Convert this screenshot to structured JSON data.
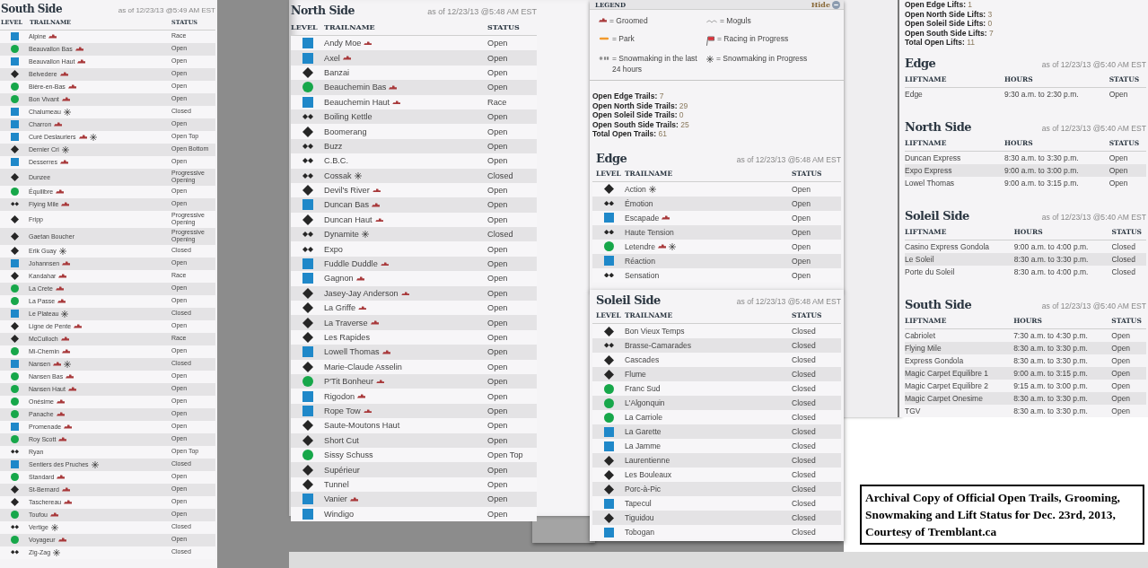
{
  "south_trails": {
    "title": "South Side",
    "as_of": "as of 12/23/13 @5:49 AM EST",
    "columns": [
      "LEVEL",
      "TRAILNAME",
      "STATUS"
    ],
    "rows": [
      {
        "name": "Alpine",
        "kind": "square",
        "groomed": true,
        "snowmaking": false,
        "status": "Race"
      },
      {
        "name": "Beauvallon Bas",
        "kind": "circle",
        "groomed": true,
        "snowmaking": false,
        "status": "Open"
      },
      {
        "name": "Beauvallon Haut",
        "kind": "square",
        "groomed": true,
        "snowmaking": false,
        "status": "Open"
      },
      {
        "name": "Belvedere",
        "kind": "diamond",
        "groomed": true,
        "snowmaking": false,
        "status": "Open"
      },
      {
        "name": "Bière-en-Bas",
        "kind": "circle",
        "groomed": true,
        "snowmaking": false,
        "status": "Open"
      },
      {
        "name": "Bon Vivant",
        "kind": "circle",
        "groomed": true,
        "snowmaking": false,
        "status": "Open"
      },
      {
        "name": "Chalumeau",
        "kind": "square",
        "groomed": false,
        "snowmaking": true,
        "status": "Closed"
      },
      {
        "name": "Charron",
        "kind": "square",
        "groomed": true,
        "snowmaking": false,
        "status": "Open"
      },
      {
        "name": "Curé Deslauriers",
        "kind": "square",
        "groomed": true,
        "snowmaking": true,
        "status": "Open Top"
      },
      {
        "name": "Dernier Cri",
        "kind": "diamond",
        "groomed": false,
        "snowmaking": true,
        "status": "Open Bottom"
      },
      {
        "name": "Desserres",
        "kind": "square",
        "groomed": true,
        "snowmaking": false,
        "status": "Open"
      },
      {
        "name": "Dunzee",
        "kind": "diamond",
        "groomed": false,
        "snowmaking": false,
        "status": "Progressive Opening"
      },
      {
        "name": "Équilibre",
        "kind": "circle",
        "groomed": true,
        "snowmaking": false,
        "status": "Open"
      },
      {
        "name": "Flying Mile",
        "kind": "double_diamond",
        "groomed": true,
        "snowmaking": false,
        "status": "Open"
      },
      {
        "name": "Fripp",
        "kind": "diamond",
        "groomed": false,
        "snowmaking": false,
        "status": "Progressive Opening"
      },
      {
        "name": "Gaetan Boucher",
        "kind": "diamond",
        "groomed": false,
        "snowmaking": false,
        "status": "Progressive Opening"
      },
      {
        "name": "Erik Guay",
        "kind": "diamond",
        "groomed": false,
        "snowmaking": true,
        "status": "Closed"
      },
      {
        "name": "Johannsen",
        "kind": "square",
        "groomed": true,
        "snowmaking": false,
        "status": "Open"
      },
      {
        "name": "Kandahar",
        "kind": "diamond",
        "groomed": true,
        "snowmaking": false,
        "status": "Race"
      },
      {
        "name": "La Crete",
        "kind": "circle",
        "groomed": true,
        "snowmaking": false,
        "status": "Open"
      },
      {
        "name": "La Passe",
        "kind": "circle",
        "groomed": true,
        "snowmaking": false,
        "status": "Open"
      },
      {
        "name": "Le Plateau",
        "kind": "square",
        "groomed": false,
        "snowmaking": true,
        "status": "Closed"
      },
      {
        "name": "Ligne de Pente",
        "kind": "diamond",
        "groomed": true,
        "snowmaking": false,
        "status": "Open"
      },
      {
        "name": "McCulloch",
        "kind": "diamond",
        "groomed": true,
        "snowmaking": false,
        "status": "Race"
      },
      {
        "name": "Mi-Chemin",
        "kind": "circle",
        "groomed": true,
        "snowmaking": false,
        "status": "Open"
      },
      {
        "name": "Nansen",
        "kind": "square",
        "groomed": true,
        "snowmaking": true,
        "status": "Closed"
      },
      {
        "name": "Nansen Bas",
        "kind": "circle",
        "groomed": true,
        "snowmaking": false,
        "status": "Open"
      },
      {
        "name": "Nansen Haut",
        "kind": "circle",
        "groomed": true,
        "snowmaking": false,
        "status": "Open"
      },
      {
        "name": "Onésime",
        "kind": "circle",
        "groomed": true,
        "snowmaking": false,
        "status": "Open"
      },
      {
        "name": "Panache",
        "kind": "circle",
        "groomed": true,
        "snowmaking": false,
        "status": "Open"
      },
      {
        "name": "Promenade",
        "kind": "square",
        "groomed": true,
        "snowmaking": false,
        "status": "Open"
      },
      {
        "name": "Roy Scott",
        "kind": "circle",
        "groomed": true,
        "snowmaking": false,
        "status": "Open"
      },
      {
        "name": "Ryan",
        "kind": "double_diamond",
        "groomed": false,
        "snowmaking": false,
        "status": "Open Top"
      },
      {
        "name": "Sentiers des Pruches",
        "kind": "square",
        "groomed": false,
        "snowmaking": true,
        "status": "Closed"
      },
      {
        "name": "Standard",
        "kind": "circle",
        "groomed": true,
        "snowmaking": false,
        "status": "Open"
      },
      {
        "name": "St-Bernard",
        "kind": "diamond",
        "groomed": true,
        "snowmaking": false,
        "status": "Open"
      },
      {
        "name": "Taschereau",
        "kind": "diamond",
        "groomed": true,
        "snowmaking": false,
        "status": "Open"
      },
      {
        "name": "Toufou",
        "kind": "circle",
        "groomed": true,
        "snowmaking": false,
        "status": "Open"
      },
      {
        "name": "Vertige",
        "kind": "double_diamond",
        "groomed": false,
        "snowmaking": true,
        "status": "Closed"
      },
      {
        "name": "Voyageur",
        "kind": "circle",
        "groomed": true,
        "snowmaking": false,
        "status": "Open"
      },
      {
        "name": "Zig-Zag",
        "kind": "double_diamond",
        "groomed": false,
        "snowmaking": true,
        "status": "Closed"
      }
    ]
  },
  "north_trails": {
    "title": "North Side",
    "as_of": "as of 12/23/13 @5:48 AM EST",
    "columns": [
      "LEVEL",
      "TRAILNAME",
      "STATUS"
    ],
    "rows": [
      {
        "name": "Andy Moe",
        "kind": "square",
        "groomed": true,
        "snowmaking": false,
        "status": "Open"
      },
      {
        "name": "Axel",
        "kind": "square",
        "groomed": true,
        "snowmaking": false,
        "status": "Open"
      },
      {
        "name": "Banzai",
        "kind": "diamond",
        "groomed": false,
        "snowmaking": false,
        "status": "Open"
      },
      {
        "name": "Beauchemin Bas",
        "kind": "circle",
        "groomed": true,
        "snowmaking": false,
        "status": "Open"
      },
      {
        "name": "Beauchemin Haut",
        "kind": "square",
        "groomed": true,
        "snowmaking": false,
        "status": "Race"
      },
      {
        "name": "Boiling Kettle",
        "kind": "double_diamond",
        "groomed": false,
        "snowmaking": false,
        "status": "Open"
      },
      {
        "name": "Boomerang",
        "kind": "diamond",
        "groomed": false,
        "snowmaking": false,
        "status": "Open"
      },
      {
        "name": "Buzz",
        "kind": "double_diamond",
        "groomed": false,
        "snowmaking": false,
        "status": "Open"
      },
      {
        "name": "C.B.C.",
        "kind": "double_diamond",
        "groomed": false,
        "snowmaking": false,
        "status": "Open"
      },
      {
        "name": "Cossak",
        "kind": "double_diamond",
        "groomed": false,
        "snowmaking": true,
        "status": "Closed"
      },
      {
        "name": "Devil's River",
        "kind": "diamond",
        "groomed": true,
        "snowmaking": false,
        "status": "Open"
      },
      {
        "name": "Duncan Bas",
        "kind": "square",
        "groomed": true,
        "snowmaking": false,
        "status": "Open"
      },
      {
        "name": "Duncan Haut",
        "kind": "diamond",
        "groomed": true,
        "snowmaking": false,
        "status": "Open"
      },
      {
        "name": "Dynamite",
        "kind": "double_diamond",
        "groomed": false,
        "snowmaking": true,
        "status": "Closed"
      },
      {
        "name": "Expo",
        "kind": "double_diamond",
        "groomed": false,
        "snowmaking": false,
        "status": "Open"
      },
      {
        "name": "Fuddle Duddle",
        "kind": "square",
        "groomed": true,
        "snowmaking": false,
        "status": "Open"
      },
      {
        "name": "Gagnon",
        "kind": "square",
        "groomed": true,
        "snowmaking": false,
        "status": "Open"
      },
      {
        "name": "Jasey-Jay Anderson",
        "kind": "diamond",
        "groomed": true,
        "snowmaking": false,
        "status": "Open"
      },
      {
        "name": "La Griffe",
        "kind": "diamond",
        "groomed": true,
        "snowmaking": false,
        "status": "Open"
      },
      {
        "name": "La Traverse",
        "kind": "diamond",
        "groomed": true,
        "snowmaking": false,
        "status": "Open"
      },
      {
        "name": "Les Rapides",
        "kind": "diamond",
        "groomed": false,
        "snowmaking": false,
        "status": "Open"
      },
      {
        "name": "Lowell Thomas",
        "kind": "square",
        "groomed": true,
        "snowmaking": false,
        "status": "Open"
      },
      {
        "name": "Marie-Claude Asselin",
        "kind": "diamond",
        "groomed": false,
        "snowmaking": false,
        "status": "Open"
      },
      {
        "name": "P'Tit Bonheur",
        "kind": "circle",
        "groomed": true,
        "snowmaking": false,
        "status": "Open"
      },
      {
        "name": "Rigodon",
        "kind": "square",
        "groomed": true,
        "snowmaking": false,
        "status": "Open"
      },
      {
        "name": "Rope Tow",
        "kind": "square",
        "groomed": true,
        "snowmaking": false,
        "status": "Open"
      },
      {
        "name": "Saute-Moutons Haut",
        "kind": "diamond",
        "groomed": false,
        "snowmaking": false,
        "status": "Open"
      },
      {
        "name": "Short Cut",
        "kind": "diamond",
        "groomed": false,
        "snowmaking": false,
        "status": "Open"
      },
      {
        "name": "Sissy Schuss",
        "kind": "circle",
        "groomed": false,
        "snowmaking": false,
        "status": "Open Top"
      },
      {
        "name": "Supérieur",
        "kind": "diamond",
        "groomed": false,
        "snowmaking": false,
        "status": "Open"
      },
      {
        "name": "Tunnel",
        "kind": "diamond",
        "groomed": false,
        "snowmaking": false,
        "status": "Open"
      },
      {
        "name": "Vanier",
        "kind": "square",
        "groomed": true,
        "snowmaking": false,
        "status": "Open"
      },
      {
        "name": "Windigo",
        "kind": "square",
        "groomed": false,
        "snowmaking": false,
        "status": "Open"
      }
    ]
  },
  "legend": {
    "title": "LEGEND",
    "hide": "Hide",
    "items": [
      {
        "kind": "groomed",
        "label": "= Groomed"
      },
      {
        "kind": "moguls",
        "label": "= Moguls"
      },
      {
        "kind": "park",
        "label": "= Park"
      },
      {
        "kind": "racing",
        "label": "= Racing in Progress"
      },
      {
        "kind": "snowmaking_24h",
        "label": "= Snowmaking in the last 24 hours"
      },
      {
        "kind": "snowmaking",
        "label": "= Snowmaking in Progress"
      }
    ]
  },
  "trail_counts": [
    "**Open Edge Trails:** 7",
    "**Open North Side Trails:** 29",
    "**Open Soleil Side Trails:** 0",
    "**Open South Side Trails:** 25",
    "**Total Open Trails:** 61"
  ],
  "edge_trails": {
    "title": "Edge",
    "as_of": "as of 12/23/13 @5:48 AM EST",
    "columns": [
      "LEVEL",
      "TRAILNAME",
      "STATUS"
    ],
    "rows": [
      {
        "name": "Action",
        "kind": "diamond",
        "groomed": false,
        "snowmaking": true,
        "status": "Open"
      },
      {
        "name": "Émotion",
        "kind": "double_diamond",
        "groomed": false,
        "snowmaking": false,
        "status": "Open"
      },
      {
        "name": "Escapade",
        "kind": "square",
        "groomed": true,
        "snowmaking": false,
        "status": "Open"
      },
      {
        "name": "Haute Tension",
        "kind": "double_diamond",
        "groomed": false,
        "snowmaking": false,
        "status": "Open"
      },
      {
        "name": "Letendre",
        "kind": "circle",
        "groomed": true,
        "snowmaking": true,
        "status": "Open"
      },
      {
        "name": "Réaction",
        "kind": "square",
        "groomed": false,
        "snowmaking": false,
        "status": "Open"
      },
      {
        "name": "Sensation",
        "kind": "double_diamond",
        "groomed": false,
        "snowmaking": false,
        "status": "Open"
      }
    ]
  },
  "soleil_trails": {
    "title": "Soleil Side",
    "as_of": "as of 12/23/13 @5:48 AM EST",
    "columns": [
      "LEVEL",
      "TRAILNAME",
      "STATUS"
    ],
    "rows": [
      {
        "name": "Bon Vieux Temps",
        "kind": "diamond",
        "groomed": false,
        "snowmaking": false,
        "status": "Closed"
      },
      {
        "name": "Brasse-Camarades",
        "kind": "double_diamond",
        "groomed": false,
        "snowmaking": false,
        "status": "Closed"
      },
      {
        "name": "Cascades",
        "kind": "diamond",
        "groomed": false,
        "snowmaking": false,
        "status": "Closed"
      },
      {
        "name": "Flume",
        "kind": "diamond",
        "groomed": false,
        "snowmaking": false,
        "status": "Closed"
      },
      {
        "name": "Franc Sud",
        "kind": "circle",
        "groomed": false,
        "snowmaking": false,
        "status": "Closed"
      },
      {
        "name": "L'Algonquin",
        "kind": "circle",
        "groomed": false,
        "snowmaking": false,
        "status": "Closed"
      },
      {
        "name": "La Carriole",
        "kind": "circle",
        "groomed": false,
        "snowmaking": false,
        "status": "Closed"
      },
      {
        "name": "La Garette",
        "kind": "square",
        "groomed": false,
        "snowmaking": false,
        "status": "Closed"
      },
      {
        "name": "La Jamme",
        "kind": "square",
        "groomed": false,
        "snowmaking": false,
        "status": "Closed"
      },
      {
        "name": "Laurentienne",
        "kind": "diamond",
        "groomed": false,
        "snowmaking": false,
        "status": "Closed"
      },
      {
        "name": "Les Bouleaux",
        "kind": "diamond",
        "groomed": false,
        "snowmaking": false,
        "status": "Closed"
      },
      {
        "name": "Porc-à-Pic",
        "kind": "diamond",
        "groomed": false,
        "snowmaking": false,
        "status": "Closed"
      },
      {
        "name": "Tapecul",
        "kind": "square",
        "groomed": false,
        "snowmaking": false,
        "status": "Closed"
      },
      {
        "name": "Tiguidou",
        "kind": "diamond",
        "groomed": false,
        "snowmaking": false,
        "status": "Closed"
      },
      {
        "name": "Tobogan",
        "kind": "square",
        "groomed": false,
        "snowmaking": false,
        "status": "Closed"
      }
    ]
  },
  "lift_counts": [
    "**Open Edge Lifts:** 1",
    "**Open North Side Lifts:** 3",
    "**Open Soleil Side Lifts:** 0",
    "**Open South Side Lifts:** 7",
    "**Total Open Lifts:** 11"
  ],
  "lift_sections": [
    {
      "title": "Edge",
      "as_of": "as of 12/23/13 @5:40 AM EST",
      "columns": [
        "LIFTNAME",
        "HOURS",
        "STATUS"
      ],
      "rows": [
        {
          "name": "Edge",
          "hours": "9:30 a.m. to 2:30 p.m.",
          "status": "Open"
        }
      ]
    },
    {
      "title": "North Side",
      "as_of": "as of 12/23/13 @5:40 AM EST",
      "columns": [
        "LIFTNAME",
        "HOURS",
        "STATUS"
      ],
      "rows": [
        {
          "name": "Duncan Express",
          "hours": "8:30 a.m. to 3:30 p.m.",
          "status": "Open"
        },
        {
          "name": "Expo Express",
          "hours": "9:00 a.m. to 3:00 p.m.",
          "status": "Open"
        },
        {
          "name": "Lowel Thomas",
          "hours": "9:00 a.m. to 3:15 p.m.",
          "status": "Open"
        }
      ]
    },
    {
      "title": "Soleil Side",
      "as_of": "as of 12/23/13 @5:40 AM EST",
      "columns": [
        "LIFTNAME",
        "HOURS",
        "STATUS"
      ],
      "rows": [
        {
          "name": "Casino Express Gondola",
          "hours": "9:00 a.m. to 4:00 p.m.",
          "status": "Closed"
        },
        {
          "name": "Le Soleil",
          "hours": "8:30 a.m. to 3:30 p.m.",
          "status": "Closed"
        },
        {
          "name": "Porte du Soleil",
          "hours": "8:30 a.m. to 4:00 p.m.",
          "status": "Closed"
        }
      ]
    },
    {
      "title": "South Side",
      "as_of": "as of 12/23/13 @5:40 AM EST",
      "columns": [
        "LIFTNAME",
        "HOURS",
        "STATUS"
      ],
      "rows": [
        {
          "name": "Cabriolet",
          "hours": "7:30 a.m. to 4:30 p.m.",
          "status": "Open"
        },
        {
          "name": "Flying Mile",
          "hours": "8:30 a.m. to 3:30 p.m.",
          "status": "Open"
        },
        {
          "name": "Express Gondola",
          "hours": "8:30 a.m. to 3:30 p.m.",
          "status": "Open"
        },
        {
          "name": "Magic Carpet Equilibre 1",
          "hours": "9:00 a.m. to 3:15 p.m.",
          "status": "Open"
        },
        {
          "name": "Magic Carpet Equilibre 2",
          "hours": "9:15 a.m. to 3:00 p.m.",
          "status": "Open"
        },
        {
          "name": "Magic Carpet Onesime",
          "hours": "8:30 a.m. to 3:30 p.m.",
          "status": "Open"
        },
        {
          "name": "TGV",
          "hours": "8:30 a.m. to 3:30 p.m.",
          "status": "Open"
        }
      ]
    }
  ],
  "note": "Archival Copy of Official Open Trails, Grooming, Snowmaking and Lift Status for Dec. 23rd, 2013, Courtesy of Tremblant.ca"
}
